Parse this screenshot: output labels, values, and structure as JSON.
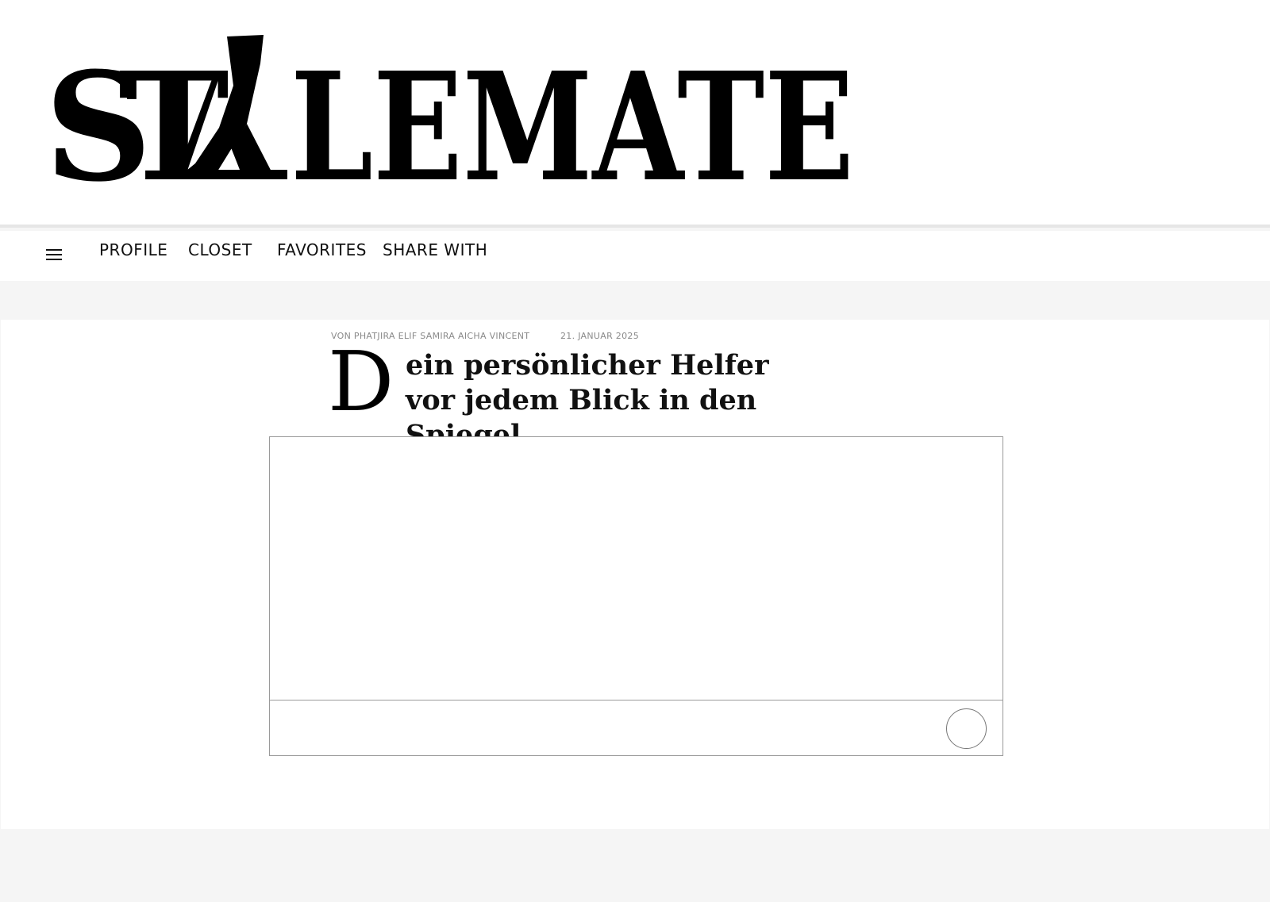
{
  "brand": {
    "logo_text": "STALEMATE"
  },
  "nav": {
    "menu_icon": "hamburger-icon",
    "items": [
      {
        "label": "PROFILE"
      },
      {
        "label": "CLOSET"
      },
      {
        "label": "FAVORITES"
      },
      {
        "label": "SHARE WITH"
      }
    ]
  },
  "article": {
    "byline": "VON PHATJIRA  ELIF  SAMIRA  AICHA  VINCENT",
    "date": "21. JANUAR 2025",
    "dropcap": "D",
    "headline": "ein persönlicher Helfer vor jedem Blick in den Spiegel."
  },
  "media": {
    "capture_icon": "circle-button-icon"
  },
  "colors": {
    "background": "#f5f5f5",
    "surface": "#ffffff",
    "text": "#111111",
    "muted": "#8a8a8a",
    "border": "#9a9a9a"
  }
}
